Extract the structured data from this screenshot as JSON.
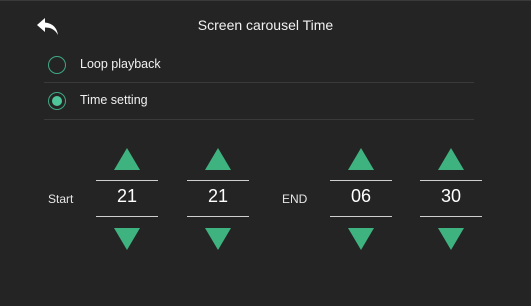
{
  "header": {
    "title": "Screen carousel Time",
    "back_icon": "back-arrow-icon"
  },
  "options": [
    {
      "label": "Loop playback",
      "checked": false
    },
    {
      "label": "Time setting",
      "checked": true
    }
  ],
  "time": {
    "start_label": "Start",
    "end_label": "END",
    "start_hour": "21",
    "start_minute": "21",
    "end_hour": "06",
    "end_minute": "30"
  },
  "colors": {
    "accent": "#3fb37f",
    "background": "#242424"
  }
}
